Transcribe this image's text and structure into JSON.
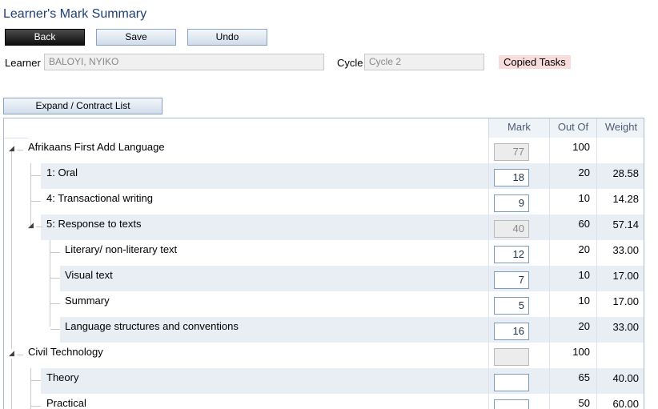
{
  "window": {
    "title": "Learner's Mark Summary"
  },
  "toolbar": {
    "back_label": "Back",
    "save_label": "Save",
    "undo_label": "Undo",
    "expand_label": "Expand / Contract List"
  },
  "form": {
    "learner_label": "Learner",
    "learner_value": "BALOYI, NYIKO",
    "cycle_label": "Cycle",
    "cycle_value": "Cycle 2",
    "badge": "Copied Tasks"
  },
  "grid": {
    "columns": {
      "mark": "Mark",
      "out_of": "Out Of",
      "weight": "Weight"
    },
    "rows": [
      {
        "label": "Afrikaans First Add Language",
        "mark": "77",
        "out_of": "100",
        "weight": ""
      },
      {
        "label": "1: Oral",
        "mark": "18",
        "out_of": "20",
        "weight": "28.58"
      },
      {
        "label": "4: Transactional writing",
        "mark": "9",
        "out_of": "10",
        "weight": "14.28"
      },
      {
        "label": "5: Response to texts",
        "mark": "40",
        "out_of": "60",
        "weight": "57.14"
      },
      {
        "label": "Literary/ non-literary text",
        "mark": "12",
        "out_of": "20",
        "weight": "33.00"
      },
      {
        "label": "Visual text",
        "mark": "7",
        "out_of": "10",
        "weight": "17.00"
      },
      {
        "label": "Summary",
        "mark": "5",
        "out_of": "10",
        "weight": "17.00"
      },
      {
        "label": "Language structures and conventions",
        "mark": "16",
        "out_of": "20",
        "weight": "33.00"
      },
      {
        "label": "Civil Technology",
        "mark": "",
        "out_of": "100",
        "weight": ""
      },
      {
        "label": "Theory",
        "mark": "",
        "out_of": "65",
        "weight": "40.00"
      },
      {
        "label": "Practical",
        "mark": "",
        "out_of": "50",
        "weight": "60.00"
      }
    ]
  }
}
